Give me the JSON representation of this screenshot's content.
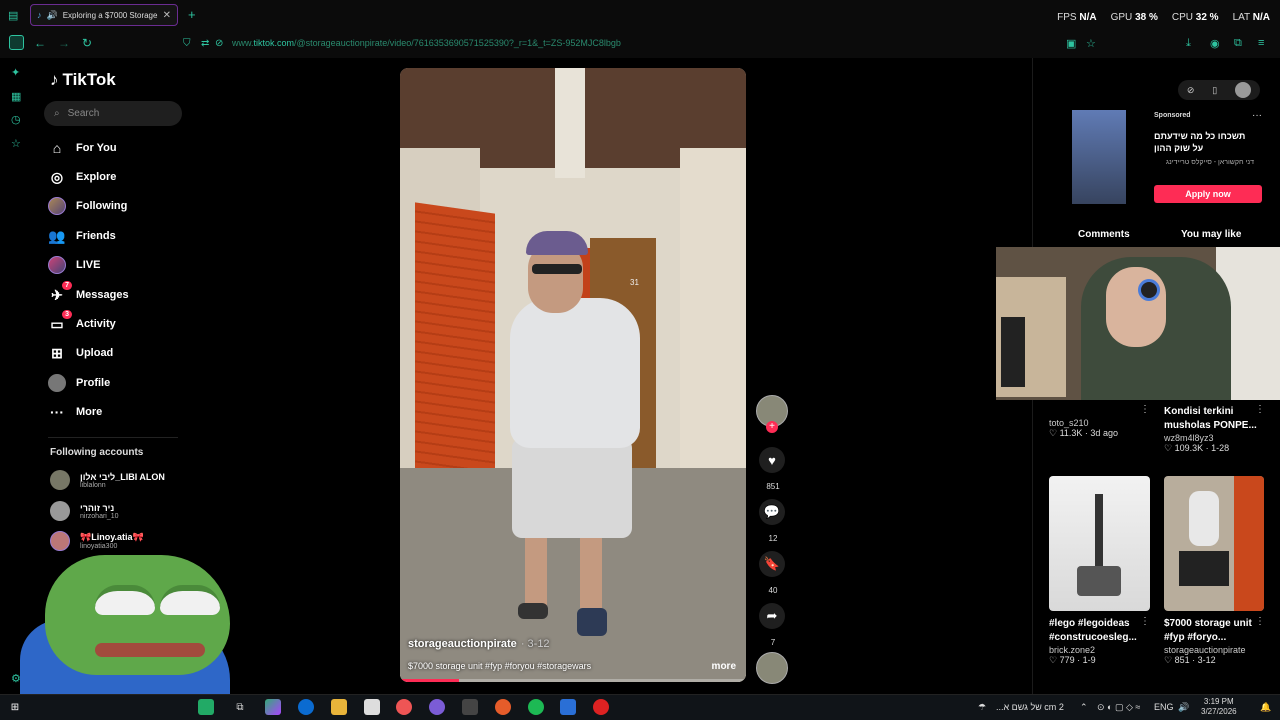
{
  "browser": {
    "tab_title": "Exploring a $7000 Storage",
    "tab_close": "✕",
    "new_tab": "+",
    "url_prefix": "www.",
    "url_domain": "tiktok.com",
    "url_path": "/@storageauctionpirate/video/7616353690571525390?_r=1&_t=ZS-952MJC8lbgb",
    "perf": {
      "fps_label": "FPS",
      "fps_value": "N/A",
      "gpu_label": "GPU",
      "gpu_value": "38 %",
      "cpu_label": "CPU",
      "cpu_value": "32 %",
      "lat_label": "LAT",
      "lat_value": "N/A"
    }
  },
  "tiktok": {
    "logo": "TikTok",
    "search_placeholder": "Search",
    "nav": [
      {
        "label": "For You",
        "icon": "home-icon"
      },
      {
        "label": "Explore",
        "icon": "compass-icon"
      },
      {
        "label": "Following",
        "icon": "following-icon"
      },
      {
        "label": "Friends",
        "icon": "friends-icon"
      },
      {
        "label": "LIVE",
        "icon": "live-icon"
      },
      {
        "label": "Messages",
        "icon": "messages-icon",
        "badge": "7"
      },
      {
        "label": "Activity",
        "icon": "activity-icon",
        "badge": "3"
      },
      {
        "label": "Upload",
        "icon": "upload-icon"
      },
      {
        "label": "Profile",
        "icon": "profile-icon"
      },
      {
        "label": "More",
        "icon": "more-icon"
      }
    ],
    "following_title": "Following accounts",
    "following": [
      {
        "name": "ליבי אלון_LIBI ALON",
        "handle": "liblalonn"
      },
      {
        "name": "ניר זוהרי",
        "handle": "nirzohari_10"
      },
      {
        "name": "🎀Linoy.atia🎀",
        "handle": "linoyatia300"
      }
    ]
  },
  "video": {
    "username": "storageauctionpirate",
    "date": "· 3-12",
    "caption": "$7000 storage unit #fyp #foryou #storagewars",
    "more": "more",
    "progress": 0.17,
    "door_number": "31"
  },
  "actions": {
    "likes": "851",
    "comments": "12",
    "saves": "40",
    "shares": "7"
  },
  "right_panel": {
    "ad_sponsored": "Sponsored",
    "ad_dots": "···",
    "ad_title": "תשכחו כל מה שידעתם על שוק ההון",
    "ad_sub": "דני חקשוראן - סייקלס טריידינג",
    "ad_button": "Apply now",
    "tab_comments": "Comments",
    "tab_you_may_like": "You may like",
    "recs": [
      {
        "title": "",
        "user": "toto_s210",
        "meta": "11.3K · 3d ago"
      },
      {
        "title": "Kondisi terkini musholas PONPE...",
        "user": "wz8m4l8yz3",
        "meta": "109.3K · 1-28"
      },
      {
        "title": "#lego #legoideas #construcoesleg...",
        "user": "brick.zone2",
        "meta": "779 · 1-9"
      },
      {
        "title": "$7000 storage unit #fyp #foryo...",
        "user": "storageauctionpirate",
        "meta": "851 · 3-12"
      }
    ]
  },
  "taskbar": {
    "weather": "2 cm של גשם א...",
    "lang": "ENG",
    "time": "3:19 PM",
    "date": "3/27/2026"
  },
  "colors": {
    "accent": "#2ec4a0",
    "tiktok_red": "#fe2c55",
    "tab_border": "#6a2c91"
  }
}
